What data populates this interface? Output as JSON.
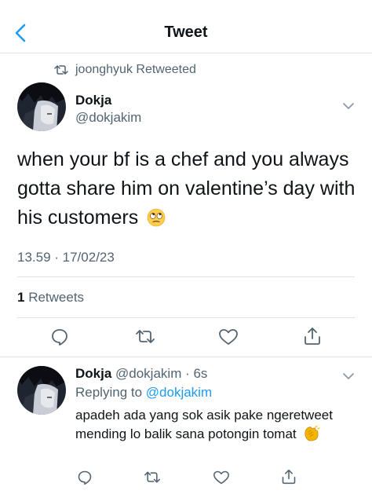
{
  "header": {
    "title": "Tweet",
    "back_icon": "chevron-left-icon"
  },
  "retweet_context": {
    "text": "joonghyuk Retweeted",
    "icon": "retweet-icon"
  },
  "main_tweet": {
    "author_name": "Dokja",
    "author_handle": "@dokjakim",
    "text": "when your bf is a chef and you always gotta share him on valentine’s day with his customers",
    "emoji": "face-with-rolling-eyes",
    "timestamp": "13.59 · 17/02/23",
    "retweet_count": "1",
    "retweet_label": " Retweets"
  },
  "reply": {
    "author_name": "Dokja",
    "meta": " @dokjakim · 6s",
    "replying_prefix": "Replying to ",
    "replying_mention": "@dokjakim",
    "text": "apadeh ada yang sok asik pake ngeretweet mending lo balik sana potongin tomat",
    "emoji": "clapping-hands"
  },
  "colors": {
    "accent": "#1d9bf0",
    "secondary_text": "#536471",
    "divider": "#dfe3e6"
  }
}
